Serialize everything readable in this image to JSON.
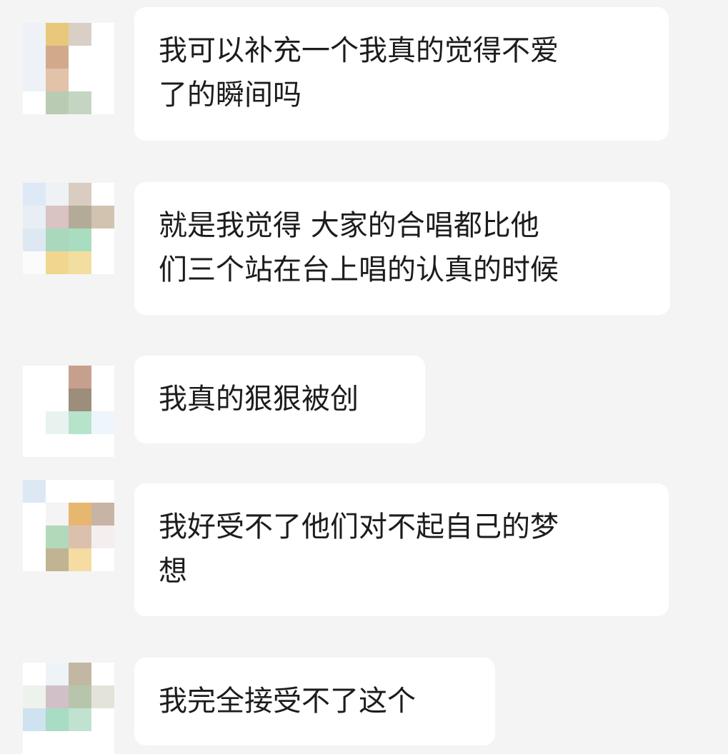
{
  "chat": {
    "messages": [
      {
        "text": "我可以补充一个我真的觉得不爱\n了的瞬间吗",
        "avatar_colors": [
          "#eef2f7",
          "#e8c87a",
          "#d9cfc6",
          "#ffffff",
          "#eef2f7",
          "#d3a98c",
          "#ffffff",
          "#ffffff",
          "#eef2f7",
          "#e2c2a8",
          "#ffffff",
          "#ffffff",
          "#ffffff",
          "#b9ccb3",
          "#c4d6c2",
          "#ffffff"
        ]
      },
      {
        "text": "就是我觉得 大家的合唱都比他\n们三个站在台上唱的认真的时候",
        "avatar_colors": [
          "#dde9f7",
          "#eef2f4",
          "#d8cdc0",
          "#ffffff",
          "#e9eef4",
          "#d9c3c3",
          "#b3ab98",
          "#d2c3b0",
          "#dde8f2",
          "#aad8bd",
          "#a9ddbf",
          "#ffffff",
          "#fbfbfb",
          "#f1d690",
          "#f2de9f",
          "#ffffff"
        ]
      },
      {
        "text": "我真的狠狠被创",
        "avatar_colors": [
          "#ffffff",
          "#ffffff",
          "#c7a08d",
          "#ffffff",
          "#ffffff",
          "#ffffff",
          "#9c8e7b",
          "#ffffff",
          "#ffffff",
          "#e8f3ef",
          "#b7e3ca",
          "#eef5fb",
          "#ffffff",
          "#ffffff",
          "#ffffff",
          "#ffffff"
        ]
      },
      {
        "text": "我好受不了他们对不起自己的梦\n想",
        "avatar_colors": [
          "#dce9f5",
          "#ffffff",
          "#ffffff",
          "#ffffff",
          "#ffffff",
          "#f4f4f4",
          "#e7b66f",
          "#c8b4a5",
          "#ffffff",
          "#b2d9b9",
          "#dcc0ae",
          "#f5eeee",
          "#ffffff",
          "#c0b493",
          "#f4dca2",
          "#ffffff"
        ]
      },
      {
        "text": "我完全接受不了这个",
        "avatar_colors": [
          "#ffffff",
          "#eef3f7",
          "#c2b7a3",
          "#ffffff",
          "#eef2ec",
          "#d1c0c7",
          "#b8c5ad",
          "#e3e3d9",
          "#cfe2f0",
          "#a9dcc4",
          "#bfe3d0",
          "#ffffff",
          "#ffffff",
          "#ffffff",
          "#ffffff",
          "#ffffff"
        ]
      }
    ]
  }
}
